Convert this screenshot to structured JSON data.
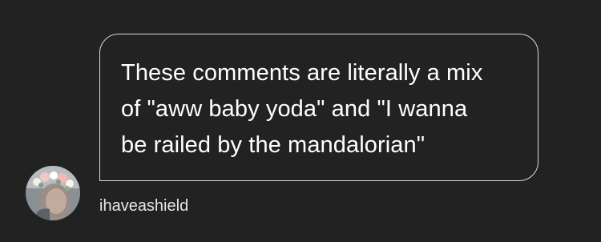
{
  "message": {
    "text": "These comments are literally a mix\nof \"aww baby yoda\" and \"I wanna\nbe railed by the mandalorian\""
  },
  "author": {
    "username": "ihaveashield",
    "avatar_icon": "profile-photo-flower-crown"
  },
  "colors": {
    "background": "#222222",
    "bubble_border": "#d9d9d9",
    "text": "#ffffff"
  }
}
